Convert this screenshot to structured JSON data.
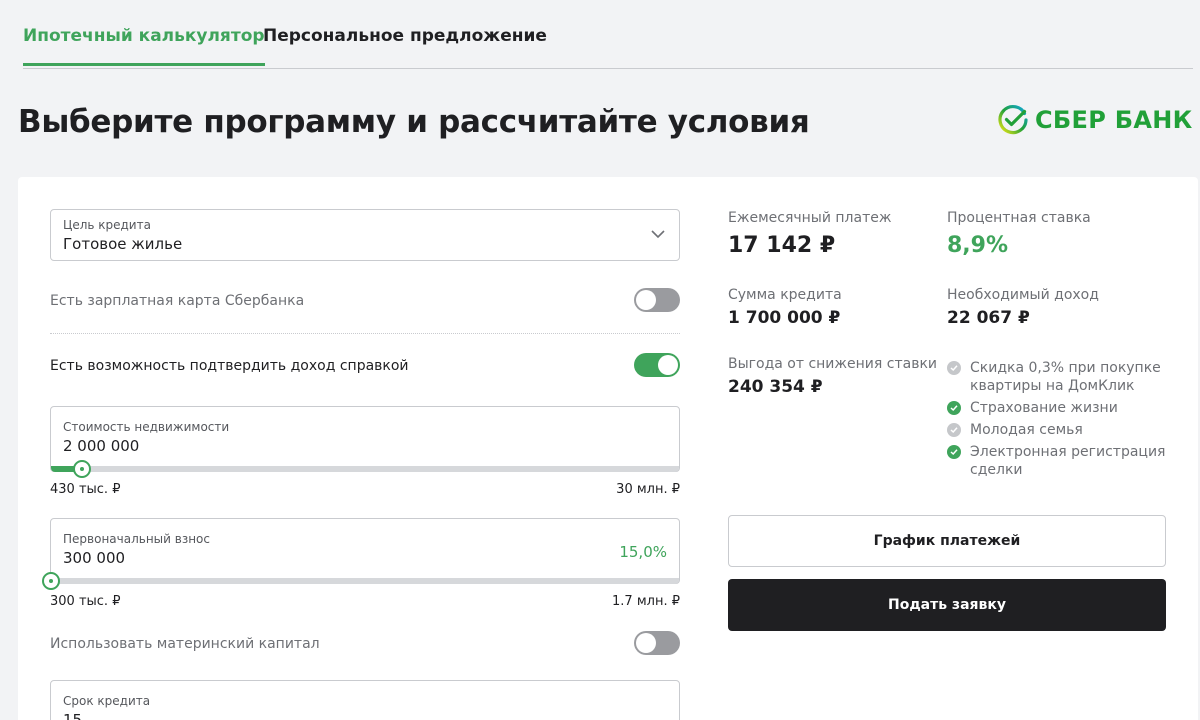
{
  "tabs": [
    {
      "label": "Ипотечный калькулятор",
      "active": true
    },
    {
      "label": "Персональное предложение",
      "active": false
    }
  ],
  "page_title": "Выберите программу и рассчитайте условия",
  "logo": {
    "text": "СБЕР БАНК",
    "brand_color": "#21a038"
  },
  "form": {
    "purpose": {
      "label": "Цель кредита",
      "value": "Готовое жилье"
    },
    "salary_card": {
      "label": "Есть зарплатная карта Сбербанка",
      "on": false
    },
    "income_proof": {
      "label": "Есть возможность подтвердить доход справкой",
      "on": true
    },
    "property_cost": {
      "label": "Стоимость недвижимости",
      "value": "2 000 000",
      "min": "430 тыс. ₽",
      "max": "30 млн. ₽",
      "fill_fraction": 0.05
    },
    "down_payment": {
      "label": "Первоначальный взнос",
      "value": "300 000",
      "percent": "15,0%",
      "min": "300 тыс. ₽",
      "max": "1.7 млн. ₽",
      "fill_fraction": 0.0
    },
    "maternity_capital": {
      "label": "Использовать материнский капитал",
      "on": false
    },
    "term": {
      "label": "Срок кредита",
      "value": "15"
    }
  },
  "results": {
    "monthly_payment": {
      "label": "Ежемесячный платеж",
      "value": "17 142 ₽"
    },
    "interest_rate": {
      "label": "Процентная ставка",
      "value": "8,9%"
    },
    "loan_amount": {
      "label": "Сумма кредита",
      "value": "1 700 000 ₽"
    },
    "required_income": {
      "label": "Необходимый доход",
      "value": "22 067 ₽"
    },
    "rate_benefit": {
      "label": "Выгода от снижения ставки",
      "value": "240 354 ₽"
    },
    "discounts": [
      {
        "label": "Скидка 0,3% при покупке квартиры на ДомКлик",
        "checked": false
      },
      {
        "label": "Страхование жизни",
        "checked": true
      },
      {
        "label": "Молодая семья",
        "checked": false
      },
      {
        "label": "Электронная регистрация сделки",
        "checked": true
      }
    ]
  },
  "buttons": {
    "schedule": "График платежей",
    "apply": "Подать заявку"
  },
  "colors": {
    "accent": "#3fa45b",
    "dark_button": "#1f1f22"
  }
}
